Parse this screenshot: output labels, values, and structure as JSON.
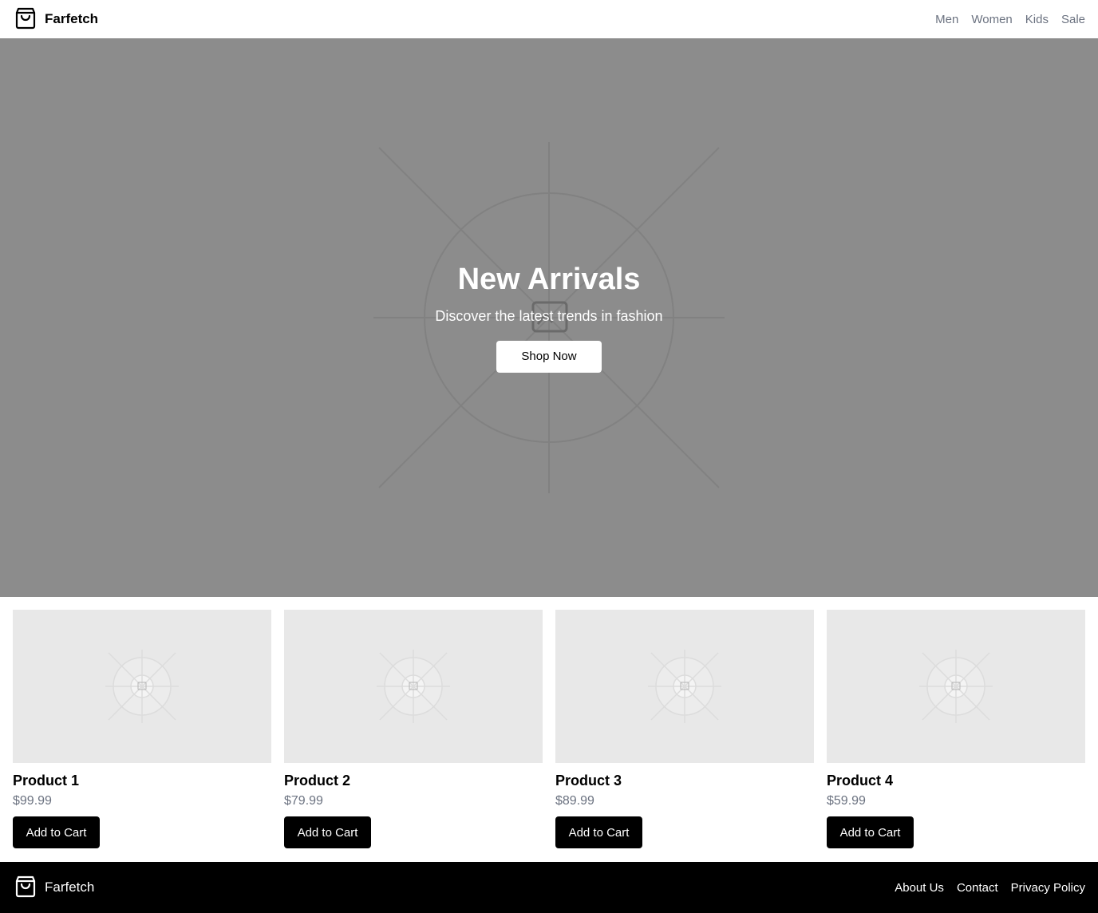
{
  "header": {
    "brand": "Farfetch",
    "logo_icon": "shopping-bag-icon",
    "nav": [
      "Men",
      "Women",
      "Kids",
      "Sale"
    ]
  },
  "hero": {
    "title": "New Arrivals",
    "subtitle": "Discover the latest trends in fashion",
    "cta_label": "Shop Now",
    "image_icon": "image-placeholder-icon"
  },
  "products": [
    {
      "name": "Product 1",
      "price": "$99.99",
      "button_label": "Add to Cart"
    },
    {
      "name": "Product 2",
      "price": "$79.99",
      "button_label": "Add to Cart"
    },
    {
      "name": "Product 3",
      "price": "$89.99",
      "button_label": "Add to Cart"
    },
    {
      "name": "Product 4",
      "price": "$59.99",
      "button_label": "Add to Cart"
    }
  ],
  "footer": {
    "brand": "Farfetch",
    "links": [
      "About Us",
      "Contact",
      "Privacy Policy"
    ]
  },
  "colors": {
    "hero_background": "#8c8c8c",
    "card_image_background": "#e8e8e8",
    "muted_text": "#6b7280",
    "button_dark": "#000000"
  }
}
